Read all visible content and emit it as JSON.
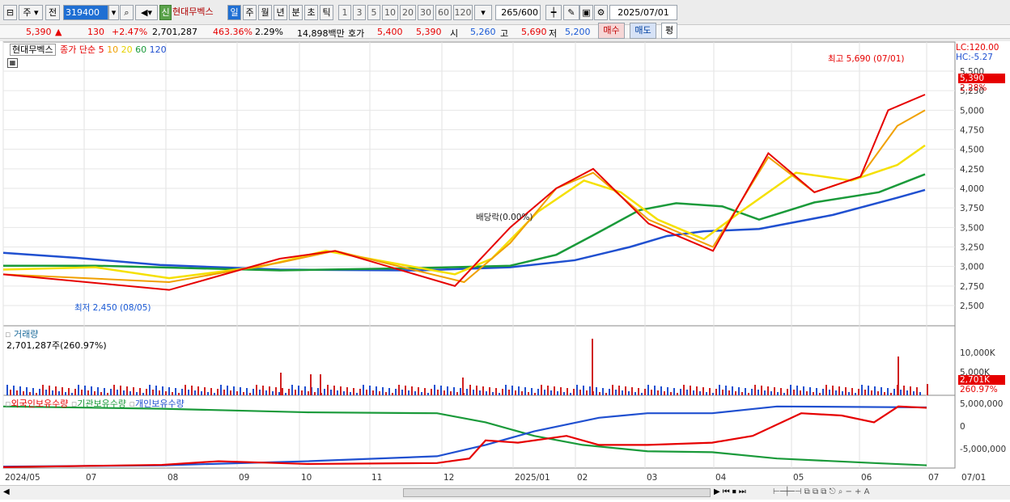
{
  "toolbar": {
    "type_label": "주",
    "market_label": "전",
    "code": "319400",
    "badge_new": "신",
    "stock_name": "현대무벡스",
    "periods": [
      "일",
      "주",
      "월",
      "년",
      "분",
      "초",
      "틱"
    ],
    "active_period": "일",
    "ticks": [
      "1",
      "3",
      "5",
      "10",
      "20",
      "30",
      "60",
      "120"
    ],
    "count": "265",
    "count_max": "/600",
    "date": "2025/07/01"
  },
  "quote": {
    "price": "5,390",
    "up_mark": "▲",
    "change": "130",
    "change_pct": "+2.47%",
    "volume": "2,701,287",
    "volume_ratio": "463.36%",
    "turnover": "2.29%",
    "amount": "14,898백만",
    "ask_label": "호가",
    "ask": "5,400",
    "bid": "5,390",
    "open_label": "시",
    "open": "5,260",
    "high_label": "고",
    "high": "5,690",
    "low_label": "저",
    "low": "5,200",
    "buy_label": "매수",
    "sell_label": "매도",
    "eval_label": "평"
  },
  "legend": {
    "name": "현대무벡스",
    "ma_title": "종가 단순",
    "ma": [
      {
        "label": "5",
        "color": "#e60000"
      },
      {
        "label": "10",
        "color": "#f0a000"
      },
      {
        "label": "20",
        "color": "#f5e000"
      },
      {
        "label": "60",
        "color": "#1a9a3a"
      },
      {
        "label": "120",
        "color": "#2050d0"
      }
    ]
  },
  "annotations": {
    "high_text": "최고 5,690 (07/01)",
    "low_text": "최저 2,450 (08/05)",
    "dividend": "배당락(0.00%)",
    "lc": "LC:120.00",
    "hc": "HC:-5.27",
    "last_price": "5,390",
    "last_pct": "2.28%",
    "vol_last": "2,701K",
    "vol_pct": "260.97%"
  },
  "volume_panel": {
    "title": "거래량",
    "value": "2,701,287주(260.97%)",
    "yticks": [
      "10,000K",
      "5,000K"
    ]
  },
  "holding_panel": {
    "series": [
      {
        "name": "외국인보유수량",
        "color": "#e60000"
      },
      {
        "name": "기관보유수량",
        "color": "#1a9a3a"
      },
      {
        "name": "개인보유수량",
        "color": "#2050d0"
      }
    ],
    "yticks": [
      "5,000,000",
      "0",
      "-5,000,000"
    ]
  },
  "price_axis": [
    "5,500",
    "5,250",
    "5,000",
    "4,750",
    "4,500",
    "4,250",
    "4,000",
    "3,750",
    "3,500",
    "3,250",
    "3,000",
    "2,750",
    "2,500"
  ],
  "x_axis": [
    "2024/05",
    "07",
    "08",
    "09",
    "10",
    "11",
    "12",
    "2025/01",
    "02",
    "03",
    "04",
    "05",
    "06",
    "07",
    "07/01"
  ],
  "colors": {
    "up": "#e60000",
    "down": "#1a5ad6",
    "accent": "#1f6fd3"
  }
}
